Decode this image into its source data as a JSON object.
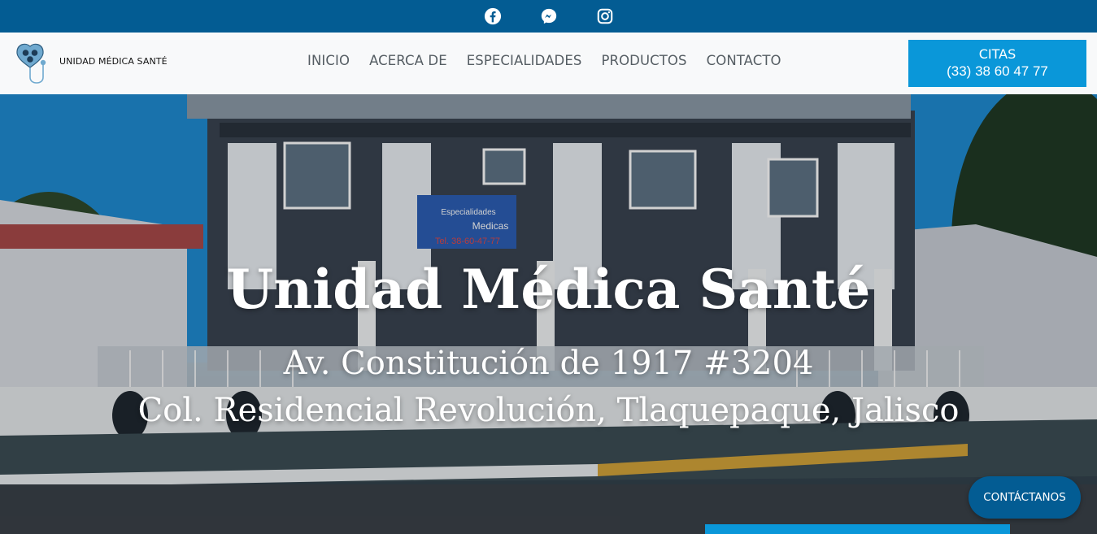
{
  "topbar": {
    "icons": [
      "facebook-icon",
      "messenger-icon",
      "instagram-icon"
    ]
  },
  "header": {
    "logo_text": "UNIDAD MÉDICA SANTÉ",
    "nav": [
      {
        "label": "INICIO"
      },
      {
        "label": "ACERCA DE"
      },
      {
        "label": "ESPECIALIDADES"
      },
      {
        "label": "PRODUCTOS"
      },
      {
        "label": "CONTACTO"
      }
    ],
    "cta": {
      "line1": "CITAS",
      "line2": "(33) 38 60 47 77"
    }
  },
  "hero": {
    "title": "Unidad Médica Santé",
    "address_line1": "Av. Constitución de 1917 #3204",
    "address_line2": "Col. Residencial Revolución, Tlaquepaque, Jalisco",
    "sign": {
      "line1": "Especialidades",
      "line2": "Medicas",
      "phone": "Tel. 38-60-47-77"
    }
  },
  "floating_button": {
    "label": "CONTÁCTANOS"
  },
  "colors": {
    "topbar": "#035c93",
    "accent": "#0a97d9",
    "header_bg": "#f8f9fa",
    "nav_text": "#555d63"
  }
}
